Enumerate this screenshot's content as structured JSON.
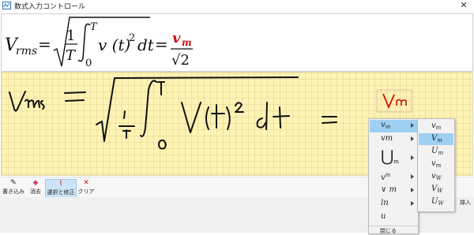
{
  "window": {
    "title": "数式入力コントロール",
    "close_glyph": "✕"
  },
  "preview_formula": {
    "lhs_base": "V",
    "lhs_sub": "rms",
    "equals": "=",
    "frac1_num": "1",
    "frac1_den": "T",
    "int_upper": "T",
    "int_lower": "0",
    "integrand": "v (t)",
    "power": "2",
    "dt": "dt",
    "equals2": "=",
    "rhs_num_base": "v",
    "rhs_num_sub": "m",
    "rhs_den": "√2",
    "highlight_color": "#d01010"
  },
  "tools": [
    {
      "label": "書き込み",
      "icon": "pen-icon"
    },
    {
      "label": "消去",
      "icon": "eraser-icon"
    },
    {
      "label": "選択と修正",
      "icon": "select-correct-icon",
      "active": true
    },
    {
      "label": "クリア",
      "icon": "clear-icon"
    }
  ],
  "insert_button": "挿入",
  "correction_menu": {
    "items": [
      {
        "base": "v",
        "sub": "m",
        "arrow": true,
        "selected": true
      },
      {
        "base": "vm",
        "arrow": true
      },
      {
        "base": "⋃",
        "sub": "m",
        "arrow": true
      },
      {
        "base": "v",
        "sup": "m",
        "arrow": true
      },
      {
        "base": "∨",
        "sub": "m",
        "arrow": true
      },
      {
        "base": "ln",
        "arrow": true
      },
      {
        "base": "u",
        "arrow": false
      }
    ],
    "close_label": "閉じる"
  },
  "sub_menu": {
    "items": [
      {
        "base": "v",
        "sub": "m"
      },
      {
        "base": "V",
        "sub": "m",
        "selected": true
      },
      {
        "base": "U",
        "sub": "m"
      },
      {
        "base": "v",
        "sub": "m"
      },
      {
        "base": "v",
        "sub": "W"
      },
      {
        "base": "V",
        "sub": "W"
      },
      {
        "base": "U",
        "sub": "W"
      }
    ]
  }
}
